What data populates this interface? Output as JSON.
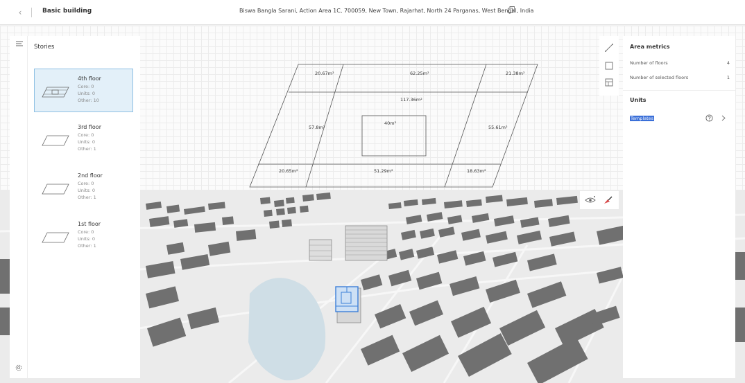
{
  "header": {
    "back_glyph": "‹",
    "title": "Basic building",
    "address": "Biswa Bangla Sarani, Action Area 1C, 700059, New Town, Rajarhat, North 24 Parganas, West Bengal, India"
  },
  "stories": {
    "title": "Stories",
    "floors": [
      {
        "name": "4th floor",
        "core": "Core: 0",
        "units": "Units: 0",
        "other": "Other: 10",
        "selected": true
      },
      {
        "name": "3rd floor",
        "core": "Core: 0",
        "units": "Units: 0",
        "other": "Other: 1",
        "selected": false
      },
      {
        "name": "2nd floor",
        "core": "Core: 0",
        "units": "Units: 0",
        "other": "Other: 1",
        "selected": false
      },
      {
        "name": "1st floor",
        "core": "Core: 0",
        "units": "Units: 0",
        "other": "Other: 1",
        "selected": false
      }
    ]
  },
  "plan": {
    "areas": {
      "top_left": "20.67m²",
      "top_mid": "62.25m²",
      "top_right": "21.38m²",
      "middle": "117.36m²",
      "left": "57.8m²",
      "core": "40m²",
      "right": "55.61m²",
      "bottom_left": "20.65m²",
      "bottom_mid": "51.29m²",
      "bottom_right": "18.63m²"
    }
  },
  "metrics": {
    "title": "Area metrics",
    "rows": [
      {
        "label": "Number of floors",
        "value": "4"
      },
      {
        "label": "Number of selected floors",
        "value": "1"
      }
    ],
    "units_title": "Units",
    "templates_label": "Templates"
  },
  "colors": {
    "accent": "#3a6fd8",
    "selected_bg": "#e3f0f9",
    "building": "#6f6f6f",
    "water": "#cfdee6"
  },
  "icons": [
    "back-icon",
    "copy-icon",
    "menu-icon",
    "settings-icon",
    "measure-icon",
    "rectangle-icon",
    "grid-icon",
    "eye-icon",
    "paint-icon",
    "help-icon",
    "chevron-right-icon"
  ]
}
